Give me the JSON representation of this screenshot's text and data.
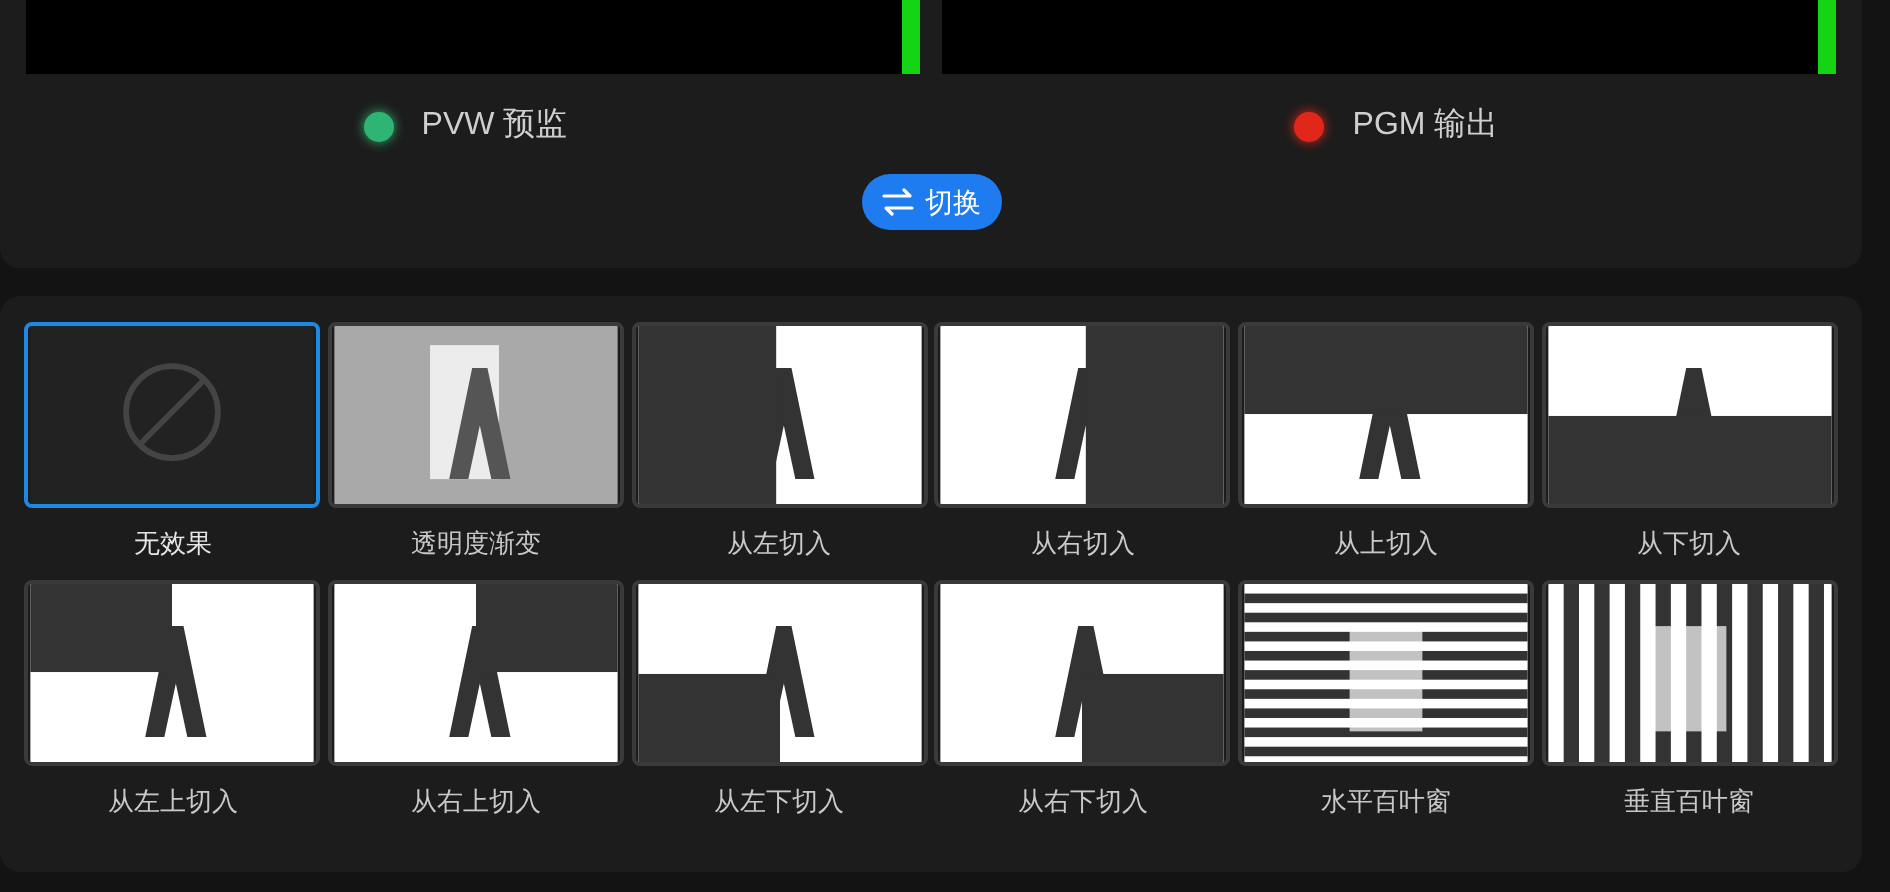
{
  "monitors": [
    {
      "label": "PVW 预监",
      "color": "#2fb573"
    },
    {
      "label": "PGM 输出",
      "color": "#e0271a"
    }
  ],
  "switch_button": {
    "label": "切换"
  },
  "effects": [
    {
      "label": "无效果",
      "kind": "none",
      "selected": true
    },
    {
      "label": "透明度渐变",
      "kind": "fade",
      "selected": false
    },
    {
      "label": "从左切入",
      "kind": "wipe-left",
      "selected": false
    },
    {
      "label": "从右切入",
      "kind": "wipe-right",
      "selected": false
    },
    {
      "label": "从上切入",
      "kind": "wipe-top",
      "selected": false
    },
    {
      "label": "从下切入",
      "kind": "wipe-bottom",
      "selected": false
    },
    {
      "label": "从左上切入",
      "kind": "wipe-top-left",
      "selected": false
    },
    {
      "label": "从右上切入",
      "kind": "wipe-top-right",
      "selected": false
    },
    {
      "label": "从左下切入",
      "kind": "wipe-bottom-left",
      "selected": false
    },
    {
      "label": "从右下切入",
      "kind": "wipe-bottom-right",
      "selected": false
    },
    {
      "label": "水平百叶窗",
      "kind": "blinds-h",
      "selected": false
    },
    {
      "label": "垂直百叶窗",
      "kind": "blinds-v",
      "selected": false
    }
  ]
}
